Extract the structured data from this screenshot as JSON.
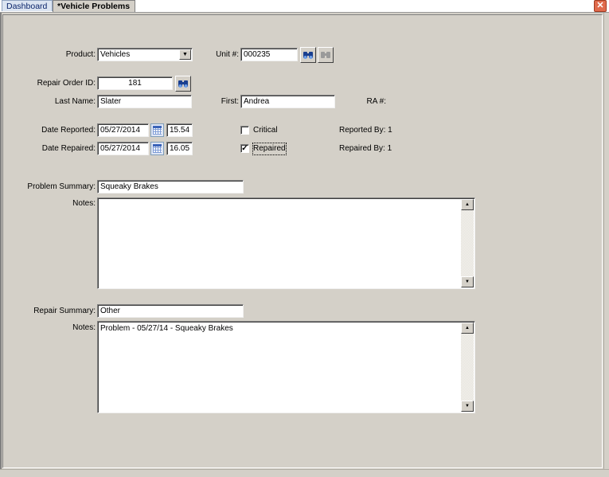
{
  "tabs": [
    {
      "label": "Dashboard"
    },
    {
      "label": "*Vehicle Problems"
    }
  ],
  "icons": {
    "close": "close-icon",
    "find": "binoculars-icon",
    "calendar": "calendar-icon",
    "dropdown": "chevron-down-icon"
  },
  "form": {
    "product": {
      "label": "Product:",
      "value": "Vehicles"
    },
    "unit": {
      "label": "Unit #:",
      "value": "000235"
    },
    "repair_order": {
      "label": "Repair Order ID:",
      "value": "181"
    },
    "last_name": {
      "label": "Last Name:",
      "value": "Slater"
    },
    "first_name": {
      "label": "First:",
      "value": "Andrea"
    },
    "ra": {
      "label": "RA #:"
    },
    "date_reported": {
      "label": "Date Reported:",
      "date": "05/27/2014",
      "time": "15.54"
    },
    "date_repaired": {
      "label": "Date Repaired:",
      "date": "05/27/2014",
      "time": "16.05"
    },
    "critical": {
      "label": "Critical",
      "checked": false
    },
    "repaired": {
      "label": "Repaired",
      "checked": true
    },
    "reported_by": {
      "label": "Reported By: 1"
    },
    "repaired_by": {
      "label": "Repaired By: 1"
    },
    "problem_summary": {
      "label": "Problem Summary:",
      "value": "Squeaky Brakes"
    },
    "problem_notes": {
      "label": "Notes:",
      "value": ""
    },
    "repair_summary": {
      "label": "Repair Summary:",
      "value": "Other"
    },
    "repair_notes": {
      "label": "Notes:",
      "value": "Problem - 05/27/14 - Squeaky Brakes"
    }
  }
}
